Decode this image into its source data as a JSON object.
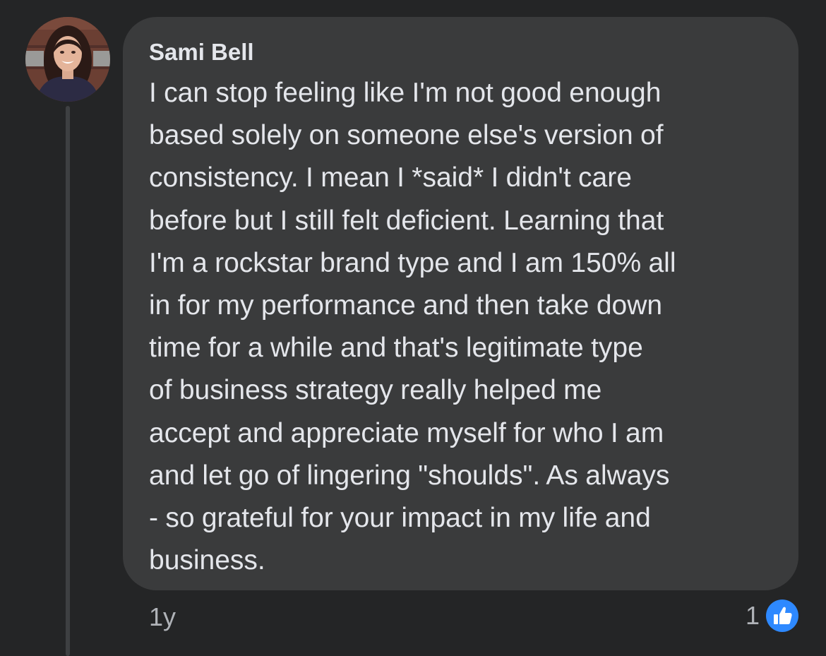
{
  "comment": {
    "author": "Sami Bell",
    "avatar": "profile-photo-woman-smiling",
    "text_lines": [
      "I can stop feeling like I'm not good enough",
      "based solely on someone else's version of",
      "consistency. I mean I *said* I didn't care",
      "before but I still felt deficient. Learning that",
      "I'm a rockstar brand type and I am 150% all",
      "in for my performance and then take down",
      "time for a while and that's legitimate type",
      "of business strategy really helped me",
      "accept and appreciate myself for who I am",
      "and let go of lingering \"shoulds\". As always",
      "- so grateful for your impact in my life and",
      "business."
    ],
    "timestamp": "1y",
    "reaction_count": "1",
    "reaction_icon": "thumbs-up-icon"
  },
  "colors": {
    "background": "#242526",
    "bubble": "#3a3b3c",
    "text": "#e4e6eb",
    "secondary_text": "#b0b3b8",
    "like_blue": "#2e89ff"
  }
}
